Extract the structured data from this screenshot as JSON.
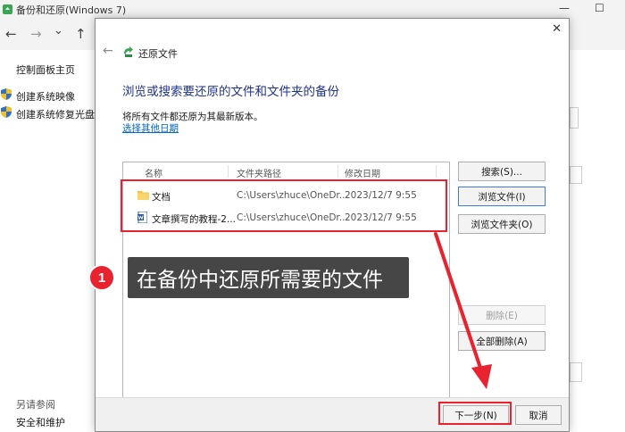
{
  "window": {
    "title": "备份和还原(Windows 7)",
    "min_glyph": "—",
    "max_glyph": "☐"
  },
  "nav": {
    "back_glyph": "←",
    "forward_glyph": "→",
    "dropdown_glyph": "⌄",
    "up_glyph": "↑"
  },
  "sidebar": {
    "home": "控制面板主页",
    "items": [
      {
        "label": "创建系统映像",
        "icon": "shield-icon"
      },
      {
        "label": "创建系统修复光盘",
        "icon": "shield-icon"
      }
    ],
    "see_also_label": "另请参阅",
    "see_also_items": [
      "安全和维护"
    ]
  },
  "dialog": {
    "close_glyph": "✕",
    "back_glyph": "←",
    "caption": "还原文件",
    "heading": "浏览或搜索要还原的文件和文件夹的备份",
    "description": "将所有文件都还原为其最新版本。",
    "link_other_date": "选择其他日期",
    "columns": {
      "name": "名称",
      "path": "文件夹路径",
      "date": "修改日期"
    },
    "files": [
      {
        "name": "文档",
        "path": "C:\\Users\\zhuce\\OneDr...",
        "date": "2023/12/7 9:55",
        "icon": "folder-icon"
      },
      {
        "name": "文章撰写的教程-2...",
        "path": "C:\\Users\\zhuce\\OneDr...",
        "date": "2023/12/7 9:55",
        "icon": "word-doc-icon"
      }
    ],
    "buttons": {
      "search": "搜索(S)...",
      "browse_files": "浏览文件(I)",
      "browse_folders": "浏览文件夹(O)",
      "remove": "删除(E)",
      "remove_all": "全部删除(A)",
      "next": "下一步(N)",
      "cancel": "取消"
    }
  },
  "annotation": {
    "number": "1",
    "text": "在备份中还原所需要的文件"
  },
  "colors": {
    "highlight_red": "#e8232f",
    "heading_blue": "#1e3287",
    "link_blue": "#0066cc",
    "label_bg": "#464646"
  }
}
